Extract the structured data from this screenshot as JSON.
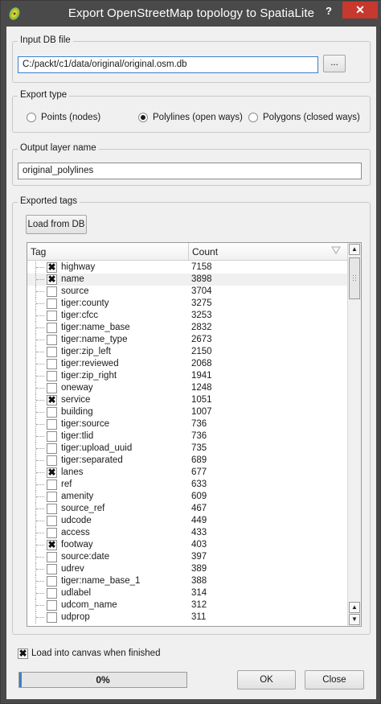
{
  "window": {
    "title": "Export OpenStreetMap topology to SpatiaLite",
    "help": "?",
    "close": "✕"
  },
  "input_db": {
    "group_title": "Input DB file",
    "value": "C:/packt/c1/data/original/original.osm.db",
    "browse_label": "..."
  },
  "export_type": {
    "group_title": "Export type",
    "options": [
      {
        "label": "Points (nodes)",
        "selected": false
      },
      {
        "label": "Polylines (open ways)",
        "selected": true
      },
      {
        "label": "Polygons (closed ways)",
        "selected": false
      }
    ]
  },
  "output_layer": {
    "group_title": "Output layer name",
    "value": "original_polylines"
  },
  "exported_tags": {
    "group_title": "Exported tags",
    "load_button": "Load from DB",
    "columns": [
      "Tag",
      "Count"
    ],
    "rows": [
      {
        "tag": "highway",
        "count": "7158",
        "checked": true
      },
      {
        "tag": "name",
        "count": "3898",
        "checked": true
      },
      {
        "tag": "source",
        "count": "3704",
        "checked": false
      },
      {
        "tag": "tiger:county",
        "count": "3275",
        "checked": false
      },
      {
        "tag": "tiger:cfcc",
        "count": "3253",
        "checked": false
      },
      {
        "tag": "tiger:name_base",
        "count": "2832",
        "checked": false
      },
      {
        "tag": "tiger:name_type",
        "count": "2673",
        "checked": false
      },
      {
        "tag": "tiger:zip_left",
        "count": "2150",
        "checked": false
      },
      {
        "tag": "tiger:reviewed",
        "count": "2068",
        "checked": false
      },
      {
        "tag": "tiger:zip_right",
        "count": "1941",
        "checked": false
      },
      {
        "tag": "oneway",
        "count": "1248",
        "checked": false
      },
      {
        "tag": "service",
        "count": "1051",
        "checked": true
      },
      {
        "tag": "building",
        "count": "1007",
        "checked": false
      },
      {
        "tag": "tiger:source",
        "count": "736",
        "checked": false
      },
      {
        "tag": "tiger:tlid",
        "count": "736",
        "checked": false
      },
      {
        "tag": "tiger:upload_uuid",
        "count": "735",
        "checked": false
      },
      {
        "tag": "tiger:separated",
        "count": "689",
        "checked": false
      },
      {
        "tag": "lanes",
        "count": "677",
        "checked": true
      },
      {
        "tag": "ref",
        "count": "633",
        "checked": false
      },
      {
        "tag": "amenity",
        "count": "609",
        "checked": false
      },
      {
        "tag": "source_ref",
        "count": "467",
        "checked": false
      },
      {
        "tag": "udcode",
        "count": "449",
        "checked": false
      },
      {
        "tag": "access",
        "count": "433",
        "checked": false
      },
      {
        "tag": "footway",
        "count": "403",
        "checked": true
      },
      {
        "tag": "source:date",
        "count": "397",
        "checked": false
      },
      {
        "tag": "udrev",
        "count": "389",
        "checked": false
      },
      {
        "tag": "tiger:name_base_1",
        "count": "388",
        "checked": false
      },
      {
        "tag": "udlabel",
        "count": "314",
        "checked": false
      },
      {
        "tag": "udcom_name",
        "count": "312",
        "checked": false
      },
      {
        "tag": "udprop",
        "count": "311",
        "checked": false
      }
    ]
  },
  "load_into_canvas": {
    "label": "Load into canvas when finished",
    "checked": true
  },
  "progress": {
    "value": 0,
    "text": "0%"
  },
  "buttons": {
    "ok": "OK",
    "close": "Close"
  },
  "icons": {
    "app": "qgis-icon",
    "sort": "sort-indicator-icon",
    "check": "✖"
  }
}
